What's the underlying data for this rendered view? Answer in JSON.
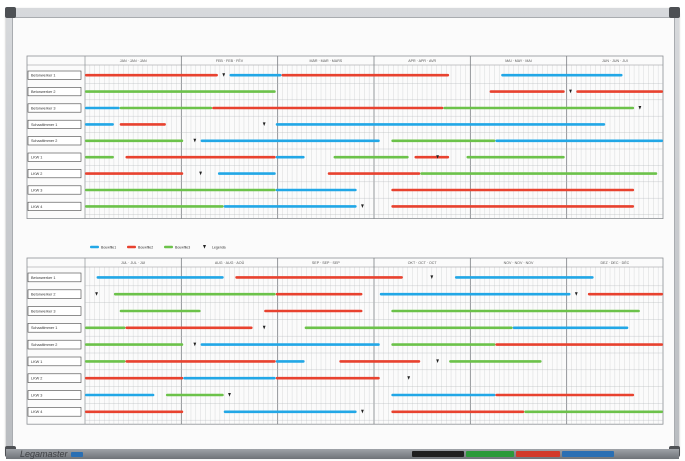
{
  "brand": {
    "name": "Legamaster"
  },
  "colors": {
    "blue": "#22a7e6",
    "red": "#e8422f",
    "green": "#6cc24a",
    "milestone": "#222222",
    "grid": "#b5b8bb",
    "marker_colors": [
      "#1f1f1f",
      "#2c9a3a",
      "#d23a2a",
      "#2a6fb3"
    ]
  },
  "legend": {
    "items": [
      {
        "label": "Bouwfile1",
        "color": "#22a7e6"
      },
      {
        "label": "Bouwfile2",
        "color": "#e8422f"
      },
      {
        "label": "Bouwfile3",
        "color": "#6cc24a"
      },
      {
        "label": "Legenda",
        "icon": "milestone-icon"
      }
    ]
  },
  "panels": [
    {
      "id": "top",
      "months": [
        "JAN · JAN · JAN",
        "FEB · FEB · FÉV",
        "MÄR · MAR · MARS",
        "APR · APR · AVR",
        "MAI · MAY · MAI",
        "JUN · JUN · JUI"
      ],
      "rows": [
        {
          "label": "Betonwerker 1",
          "bars": [
            {
              "c": "red",
              "s": 0.0,
              "e": 0.23
            },
            {
              "c": "blue",
              "s": 0.25,
              "e": 0.34
            },
            {
              "c": "red",
              "s": 0.34,
              "e": 0.63
            },
            {
              "c": "blue",
              "s": 0.72,
              "e": 0.93
            }
          ],
          "milestones": [
            0.24
          ]
        },
        {
          "label": "Betonwerker 2",
          "bars": [
            {
              "c": "green",
              "s": 0.0,
              "e": 0.33
            },
            {
              "c": "red",
              "s": 0.7,
              "e": 0.83
            },
            {
              "c": "red",
              "s": 0.85,
              "e": 1.0
            }
          ],
          "milestones": [
            0.84
          ]
        },
        {
          "label": "Betonwerker 3",
          "bars": [
            {
              "c": "blue",
              "s": 0.0,
              "e": 0.06
            },
            {
              "c": "green",
              "s": 0.06,
              "e": 0.22
            },
            {
              "c": "red",
              "s": 0.22,
              "e": 0.62
            },
            {
              "c": "green",
              "s": 0.62,
              "e": 0.95
            }
          ],
          "milestones": [
            0.96
          ]
        },
        {
          "label": "Schaaltimmer 1",
          "bars": [
            {
              "c": "blue",
              "s": 0.0,
              "e": 0.05
            },
            {
              "c": "red",
              "s": 0.06,
              "e": 0.14
            },
            {
              "c": "blue",
              "s": 0.33,
              "e": 0.9
            }
          ],
          "milestones": [
            0.31
          ]
        },
        {
          "label": "Schaaltimmer 2",
          "bars": [
            {
              "c": "green",
              "s": 0.0,
              "e": 0.17
            },
            {
              "c": "blue",
              "s": 0.2,
              "e": 0.51
            },
            {
              "c": "green",
              "s": 0.53,
              "e": 0.71
            },
            {
              "c": "blue",
              "s": 0.71,
              "e": 1.0
            }
          ],
          "milestones": [
            0.19
          ]
        },
        {
          "label": "LKW 1",
          "bars": [
            {
              "c": "green",
              "s": 0.0,
              "e": 0.05
            },
            {
              "c": "red",
              "s": 0.07,
              "e": 0.33
            },
            {
              "c": "blue",
              "s": 0.33,
              "e": 0.38
            },
            {
              "c": "green",
              "s": 0.43,
              "e": 0.56
            },
            {
              "c": "red",
              "s": 0.57,
              "e": 0.63
            },
            {
              "c": "green",
              "s": 0.66,
              "e": 0.83
            }
          ],
          "milestones": [
            0.61
          ]
        },
        {
          "label": "LKW 2",
          "bars": [
            {
              "c": "red",
              "s": 0.0,
              "e": 0.17
            },
            {
              "c": "blue",
              "s": 0.23,
              "e": 0.33
            },
            {
              "c": "red",
              "s": 0.42,
              "e": 0.58
            },
            {
              "c": "green",
              "s": 0.58,
              "e": 0.99
            }
          ],
          "milestones": [
            0.2
          ]
        },
        {
          "label": "LKW 3",
          "bars": [
            {
              "c": "green",
              "s": 0.0,
              "e": 0.33
            },
            {
              "c": "blue",
              "s": 0.33,
              "e": 0.47
            },
            {
              "c": "red",
              "s": 0.53,
              "e": 0.95
            }
          ],
          "milestones": []
        },
        {
          "label": "LKW 4",
          "bars": [
            {
              "c": "green",
              "s": 0.0,
              "e": 0.24
            },
            {
              "c": "blue",
              "s": 0.24,
              "e": 0.47
            },
            {
              "c": "red",
              "s": 0.53,
              "e": 0.95
            }
          ],
          "milestones": [
            0.48
          ]
        }
      ]
    },
    {
      "id": "bottom",
      "months": [
        "JUL · JUL · JUI",
        "AUG · AUG · AOÛ",
        "SEP · SEP · SEP",
        "OKT · OCT · OCT",
        "NOV · NOV · NOV",
        "DEZ · DEC · DÉC"
      ],
      "rows": [
        {
          "label": "Betonwerker 1",
          "bars": [
            {
              "c": "blue",
              "s": 0.02,
              "e": 0.24
            },
            {
              "c": "red",
              "s": 0.26,
              "e": 0.55
            },
            {
              "c": "blue",
              "s": 0.64,
              "e": 0.88
            }
          ],
          "milestones": [
            0.6
          ]
        },
        {
          "label": "Betonwerker 2",
          "bars": [
            {
              "c": "green",
              "s": 0.05,
              "e": 0.33
            },
            {
              "c": "red",
              "s": 0.33,
              "e": 0.48
            },
            {
              "c": "blue",
              "s": 0.51,
              "e": 0.84
            },
            {
              "c": "red",
              "s": 0.87,
              "e": 1.0
            }
          ],
          "milestones": [
            0.02,
            0.85
          ]
        },
        {
          "label": "Betonwerker 3",
          "bars": [
            {
              "c": "green",
              "s": 0.06,
              "e": 0.2
            },
            {
              "c": "red",
              "s": 0.31,
              "e": 0.48
            },
            {
              "c": "green",
              "s": 0.53,
              "e": 0.96
            }
          ],
          "milestones": []
        },
        {
          "label": "Schaaltimmer 1",
          "bars": [
            {
              "c": "green",
              "s": 0.0,
              "e": 0.07
            },
            {
              "c": "red",
              "s": 0.07,
              "e": 0.29
            },
            {
              "c": "green",
              "s": 0.38,
              "e": 0.74
            },
            {
              "c": "blue",
              "s": 0.74,
              "e": 0.94
            }
          ],
          "milestones": [
            0.31
          ]
        },
        {
          "label": "Schaaltimmer 2",
          "bars": [
            {
              "c": "green",
              "s": 0.0,
              "e": 0.17
            },
            {
              "c": "blue",
              "s": 0.2,
              "e": 0.51
            },
            {
              "c": "green",
              "s": 0.53,
              "e": 0.71
            },
            {
              "c": "red",
              "s": 0.71,
              "e": 1.0
            }
          ],
          "milestones": [
            0.19
          ]
        },
        {
          "label": "LKW 1",
          "bars": [
            {
              "c": "green",
              "s": 0.0,
              "e": 0.07
            },
            {
              "c": "red",
              "s": 0.07,
              "e": 0.33
            },
            {
              "c": "blue",
              "s": 0.33,
              "e": 0.38
            },
            {
              "c": "red",
              "s": 0.44,
              "e": 0.58
            },
            {
              "c": "green",
              "s": 0.63,
              "e": 0.79
            }
          ],
          "milestones": [
            0.61
          ]
        },
        {
          "label": "LKW 2",
          "bars": [
            {
              "c": "red",
              "s": 0.0,
              "e": 0.17
            },
            {
              "c": "blue",
              "s": 0.17,
              "e": 0.33
            },
            {
              "c": "red",
              "s": 0.33,
              "e": 0.51
            }
          ],
          "milestones": [
            0.56
          ]
        },
        {
          "label": "LKW 3",
          "bars": [
            {
              "c": "blue",
              "s": 0.0,
              "e": 0.12
            },
            {
              "c": "green",
              "s": 0.14,
              "e": 0.24
            },
            {
              "c": "blue",
              "s": 0.53,
              "e": 0.71
            },
            {
              "c": "red",
              "s": 0.71,
              "e": 0.95
            }
          ],
          "milestones": [
            0.25
          ]
        },
        {
          "label": "LKW 4",
          "bars": [
            {
              "c": "red",
              "s": 0.0,
              "e": 0.17
            },
            {
              "c": "blue",
              "s": 0.24,
              "e": 0.47
            },
            {
              "c": "red",
              "s": 0.53,
              "e": 0.76
            },
            {
              "c": "green",
              "s": 0.76,
              "e": 1.0
            }
          ],
          "milestones": [
            0.48
          ]
        }
      ]
    }
  ]
}
